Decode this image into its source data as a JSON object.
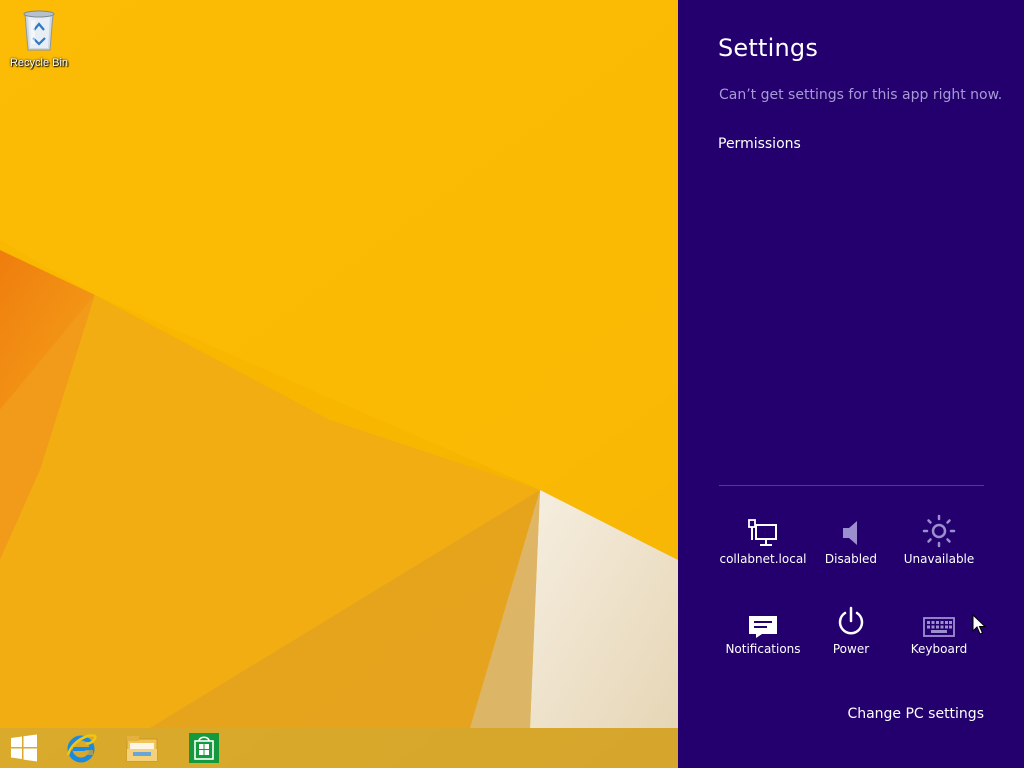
{
  "desktop": {
    "icons": [
      {
        "label": "Recycle Bin",
        "icon": "recycle-bin-icon"
      }
    ]
  },
  "taskbar": {
    "items": [
      {
        "icon": "windows-start-icon"
      },
      {
        "icon": "internet-explorer-icon"
      },
      {
        "icon": "file-explorer-icon"
      },
      {
        "icon": "store-icon"
      }
    ]
  },
  "settings": {
    "title": "Settings",
    "message": "Can’t get settings for this app right now.",
    "permissions_label": "Permissions",
    "quick_settings": [
      {
        "label": "collabnet.local",
        "icon": "network-icon"
      },
      {
        "label": "Disabled",
        "icon": "speaker-icon"
      },
      {
        "label": "Unavailable",
        "icon": "brightness-icon"
      },
      {
        "label": "Notifications",
        "icon": "notifications-icon"
      },
      {
        "label": "Power",
        "icon": "power-icon"
      },
      {
        "label": "Keyboard",
        "icon": "keyboard-icon"
      }
    ],
    "change_pc_settings_label": "Change PC settings"
  },
  "colors": {
    "charms_background": "#23006e",
    "wallpaper_yellow": "#f5b800",
    "muted_text": "#a89ad6"
  }
}
